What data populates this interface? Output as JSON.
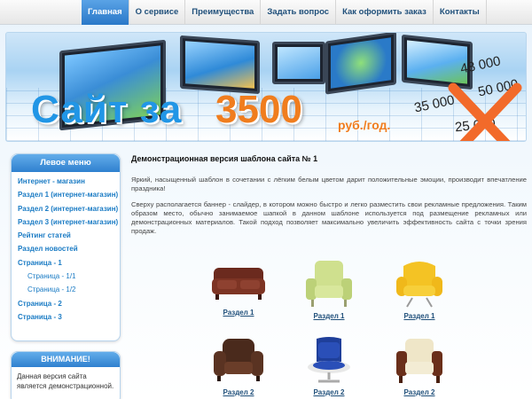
{
  "nav": {
    "items": [
      {
        "label": "Главная",
        "active": true
      },
      {
        "label": "О сервисе"
      },
      {
        "label": "Преимущества"
      },
      {
        "label": "Задать вопрос"
      },
      {
        "label": "Как оформить заказ"
      },
      {
        "label": "Контакты"
      }
    ]
  },
  "banner": {
    "title": "Сайт за",
    "price": "3500",
    "unit": "руб./год.",
    "old_prices": [
      "48 000",
      "50 000",
      "35 000",
      "25 000"
    ]
  },
  "sidebar": {
    "header": "Левое меню",
    "items": [
      {
        "label": "Интернет - магазин"
      },
      {
        "label": "Раздел 1 (интернет-магазин)"
      },
      {
        "label": "Раздел 2 (интернет-магазин)"
      },
      {
        "label": "Раздел 3 (интернет-магазин)"
      },
      {
        "label": "Рейтинг статей"
      },
      {
        "label": "Раздел новостей"
      },
      {
        "label": "Страница - 1"
      },
      {
        "label": "Страница - 1/1"
      },
      {
        "label": "Страница - 1/2"
      },
      {
        "label": "Страница - 2"
      },
      {
        "label": "Страница - 3"
      }
    ]
  },
  "notice": {
    "header": "ВНИМАНИЕ!",
    "text": "Данная версия сайта является демонстрационной."
  },
  "main": {
    "title": "Демонстрационная версия шаблона сайта № 1",
    "paragraphs": [
      "Яркий, насыщенный шаблон в сочетании с лёгким белым цветом дарит положительные эмоции, производит впечатление праздника!",
      "Сверху располагается баннер - слайдер, в котором можно быстро и легко разместить свои рекламные предложения. Таким образом место, обычно занимаемое шапкой в данном шаблоне используется под размещение рекламных или демонстрационных материалов. Такой подход позволяет максимально увеличить эффективность сайта с точки зрения продаж."
    ]
  },
  "products": [
    {
      "label": "Раздел 1",
      "icon": "brown-leather-sofa-icon"
    },
    {
      "label": "Раздел 1",
      "icon": "green-armchair-icon"
    },
    {
      "label": "Раздел 1",
      "icon": "yellow-armchair-icon"
    },
    {
      "label": "Раздел 2",
      "icon": "brown-leather-armchair-icon"
    },
    {
      "label": "Раздел 2",
      "icon": "blue-armchair-icon"
    },
    {
      "label": "Раздел 2",
      "icon": "beige-armchair-icon"
    }
  ],
  "colors": {
    "accent": "#2f80cf",
    "link": "#1a7bc4",
    "price": "#f07d1e",
    "cross": "#f26a2a"
  }
}
